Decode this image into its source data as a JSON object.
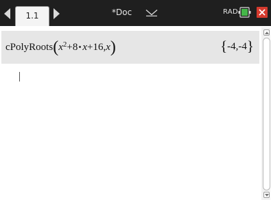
{
  "topbar": {
    "page_tab": "1.1",
    "doc_title": "*Doc",
    "angle_mode": "RAD",
    "icons": {
      "prev": "triangle-left-icon",
      "next": "triangle-right-icon",
      "doc_menu": "chevron-down-icon",
      "battery": "battery-icon",
      "close": "close-icon"
    }
  },
  "calculator": {
    "history": [
      {
        "function": "cPolyRoots",
        "base": "x",
        "exponent": "2",
        "term2_coeff": "+8",
        "term2_var": "x",
        "constant": "+16,",
        "variable": "x",
        "result": "-4,-4"
      }
    ],
    "entry_value": ""
  },
  "colors": {
    "topbar": "#1f1f1f",
    "history_row": "#e6e6e6",
    "close": "#d53a2e",
    "battery_fill": "#45b649"
  }
}
